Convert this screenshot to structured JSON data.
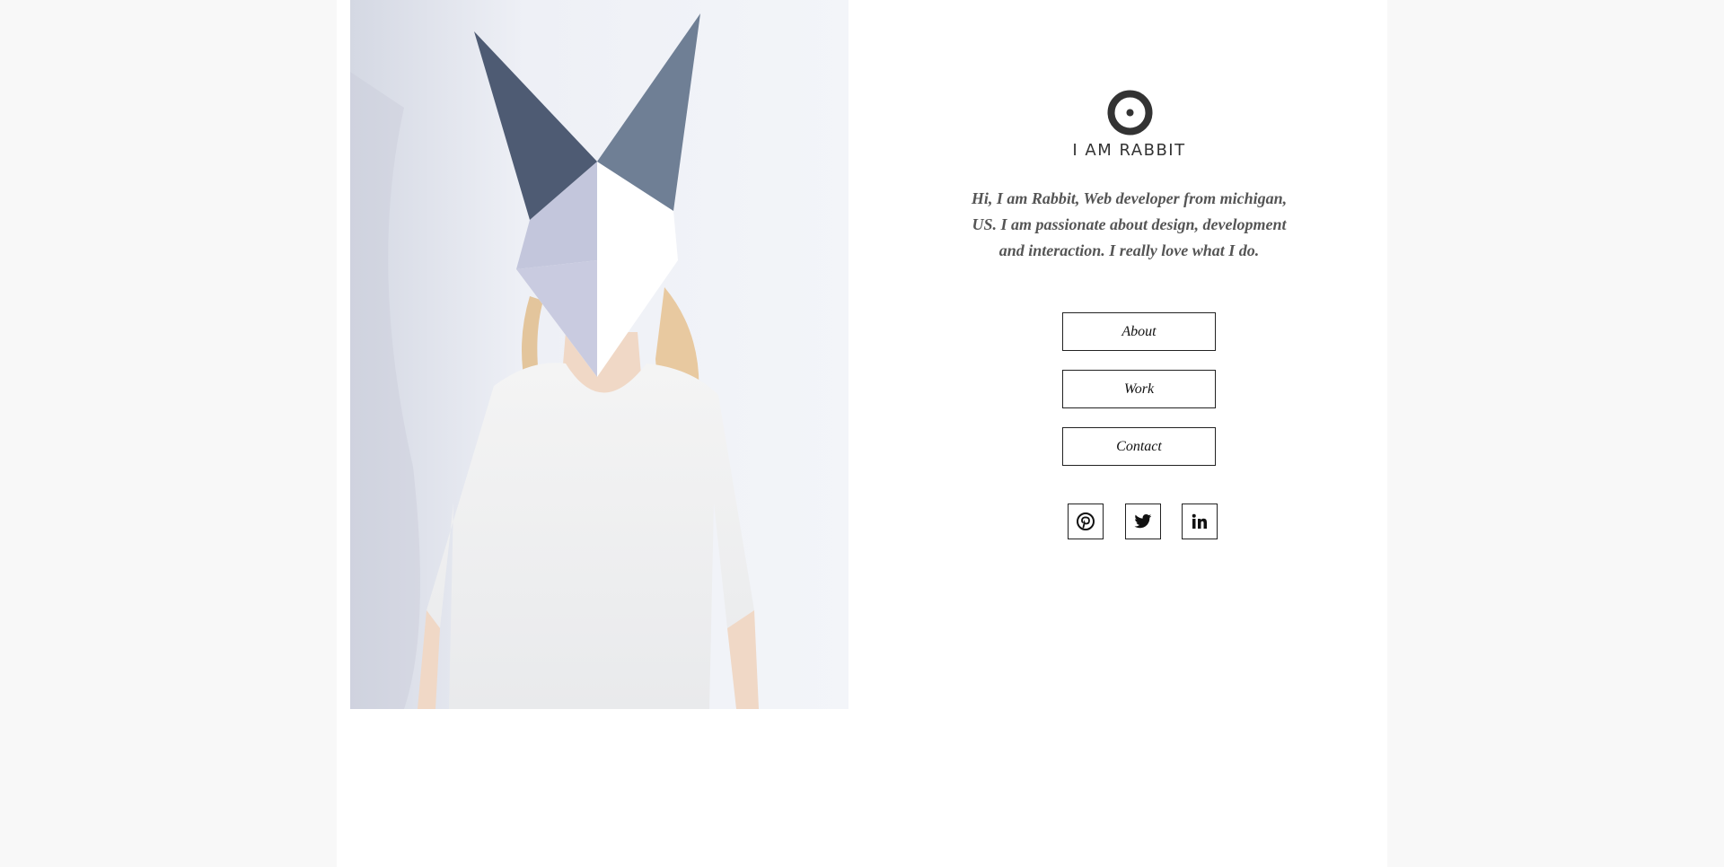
{
  "site": {
    "title": "I AM RABBIT",
    "logo_icon": "target-circle-icon"
  },
  "bio": {
    "lines": [
      "Hi, I am Rabbit, Web developer from michigan,",
      "US. I am passionate about design, development",
      "and interaction. I really love what I do."
    ]
  },
  "nav": {
    "items": [
      {
        "label": "About"
      },
      {
        "label": "Work"
      },
      {
        "label": "Contact"
      }
    ]
  },
  "social": {
    "items": [
      {
        "icon": "pinterest-icon"
      },
      {
        "icon": "twitter-icon"
      },
      {
        "icon": "linkedin-icon"
      }
    ]
  },
  "colors": {
    "background": "#f8f8f8",
    "panel": "#ffffff",
    "text_dark": "#333333",
    "border": "#222222"
  }
}
